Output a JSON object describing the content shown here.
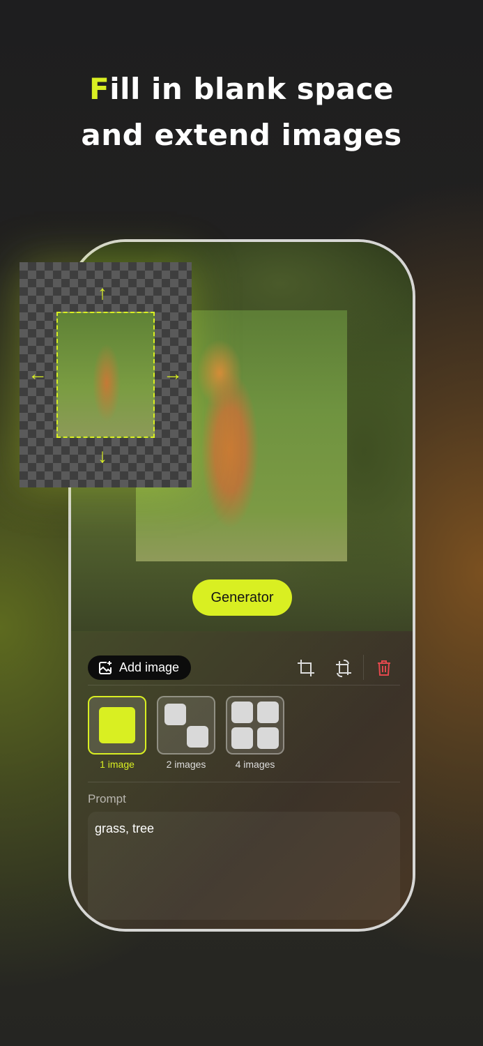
{
  "headline": {
    "highlight": "F",
    "line1_rest": "ill in blank space",
    "line2": "and extend images"
  },
  "canvas": {
    "generate_button": "Generator"
  },
  "toolbar": {
    "add_image": "Add image",
    "icons": [
      "crop-icon",
      "crop-rotate-icon",
      "trash-icon"
    ]
  },
  "output_count": {
    "options": [
      {
        "label": "1 image",
        "selected": true
      },
      {
        "label": "2 images",
        "selected": false
      },
      {
        "label": "4 images",
        "selected": false
      }
    ]
  },
  "prompt": {
    "label": "Prompt",
    "value": "grass, tree"
  },
  "colors": {
    "accent": "#d9ef22",
    "danger": "#e5484d"
  }
}
